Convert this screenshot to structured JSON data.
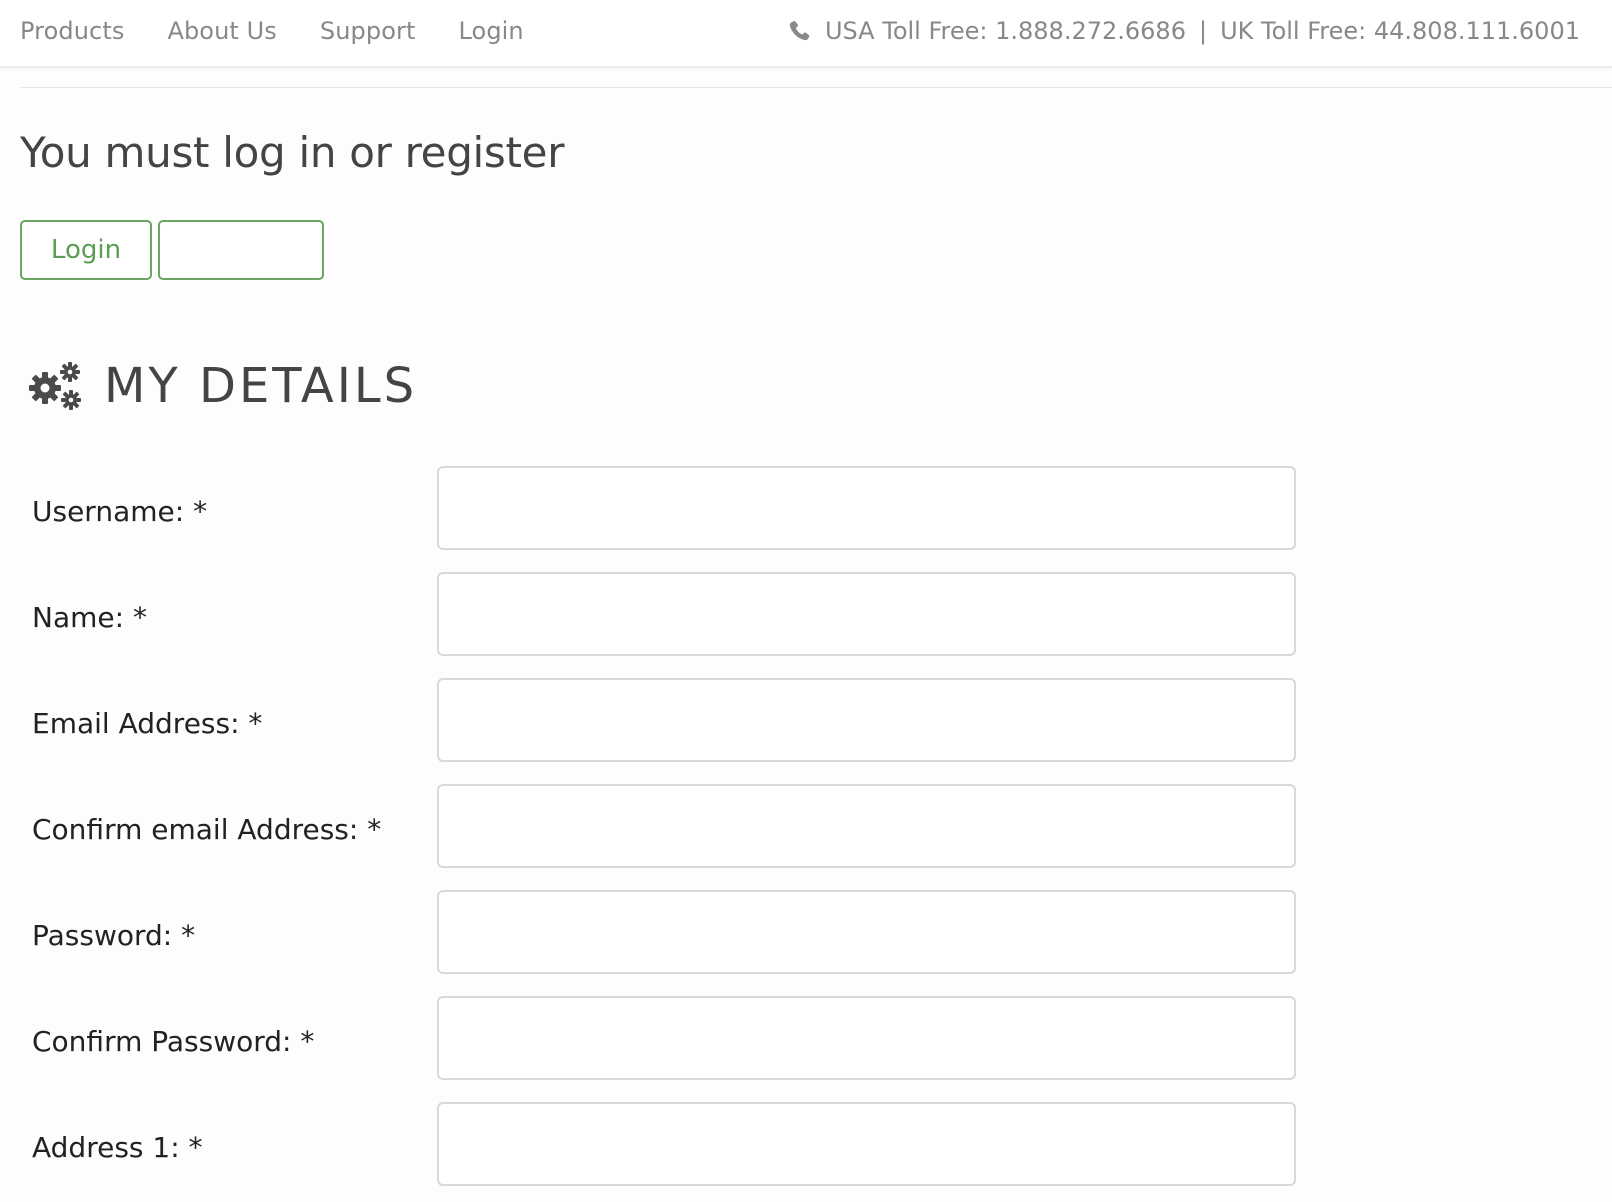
{
  "nav": {
    "items": [
      {
        "label": "Products"
      },
      {
        "label": "About Us"
      },
      {
        "label": "Support"
      },
      {
        "label": "Login"
      }
    ]
  },
  "contact": {
    "icon": "phone-icon",
    "usa": "USA Toll Free: 1.888.272.6686",
    "separator": "|",
    "uk": "UK Toll Free: 44.808.111.6001"
  },
  "page": {
    "title": "You must log in or register"
  },
  "buttons": {
    "login_label": "Login",
    "register_label": ""
  },
  "section": {
    "icon": "gears-icon",
    "title": "MY DETAILS"
  },
  "form": {
    "fields": [
      {
        "label": "Username: *",
        "value": ""
      },
      {
        "label": "Name: *",
        "value": ""
      },
      {
        "label": "Email Address: *",
        "value": ""
      },
      {
        "label": "Confirm email Address: *",
        "value": ""
      },
      {
        "label": "Password: *",
        "value": ""
      },
      {
        "label": "Confirm Password: *",
        "value": ""
      },
      {
        "label": "Address 1: *",
        "value": ""
      }
    ]
  },
  "colors": {
    "accent": "#5b9e53",
    "nav_text": "#888888",
    "heading_text": "#444444",
    "input_border": "#d9d9d9"
  }
}
